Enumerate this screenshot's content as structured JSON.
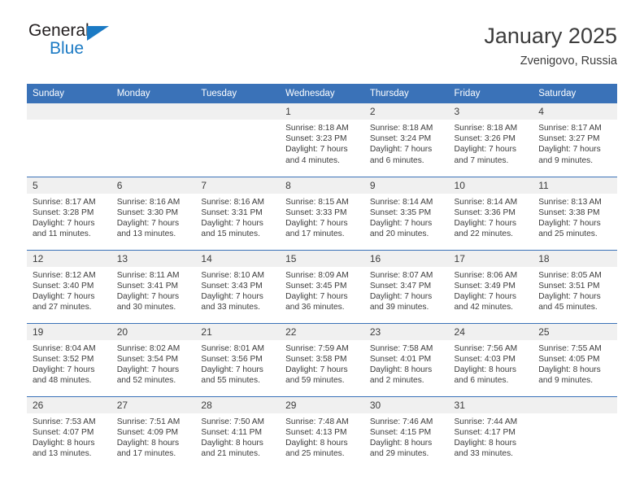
{
  "brand": {
    "name_part1": "General",
    "name_part2": "Blue",
    "triangle_icon": "triangle-icon",
    "accent_color": "#1b7ac4"
  },
  "header": {
    "title": "January 2025",
    "subtitle": "Zvenigovo, Russia"
  },
  "theme": {
    "header_blue": "#3a72b8",
    "daynum_band": "#f0f0f0",
    "text_color": "#3c3c3c"
  },
  "weekdays": [
    "Sunday",
    "Monday",
    "Tuesday",
    "Wednesday",
    "Thursday",
    "Friday",
    "Saturday"
  ],
  "labels": {
    "sunrise": "Sunrise:",
    "sunset": "Sunset:",
    "daylight": "Daylight:"
  },
  "weeks": [
    [
      {
        "day": "",
        "empty": true
      },
      {
        "day": "",
        "empty": true
      },
      {
        "day": "",
        "empty": true
      },
      {
        "day": "1",
        "sunrise": "Sunrise: 8:18 AM",
        "sunset": "Sunset: 3:23 PM",
        "daylight_line1": "Daylight: 7 hours",
        "daylight_line2": "and 4 minutes."
      },
      {
        "day": "2",
        "sunrise": "Sunrise: 8:18 AM",
        "sunset": "Sunset: 3:24 PM",
        "daylight_line1": "Daylight: 7 hours",
        "daylight_line2": "and 6 minutes."
      },
      {
        "day": "3",
        "sunrise": "Sunrise: 8:18 AM",
        "sunset": "Sunset: 3:26 PM",
        "daylight_line1": "Daylight: 7 hours",
        "daylight_line2": "and 7 minutes."
      },
      {
        "day": "4",
        "sunrise": "Sunrise: 8:17 AM",
        "sunset": "Sunset: 3:27 PM",
        "daylight_line1": "Daylight: 7 hours",
        "daylight_line2": "and 9 minutes."
      }
    ],
    [
      {
        "day": "5",
        "sunrise": "Sunrise: 8:17 AM",
        "sunset": "Sunset: 3:28 PM",
        "daylight_line1": "Daylight: 7 hours",
        "daylight_line2": "and 11 minutes."
      },
      {
        "day": "6",
        "sunrise": "Sunrise: 8:16 AM",
        "sunset": "Sunset: 3:30 PM",
        "daylight_line1": "Daylight: 7 hours",
        "daylight_line2": "and 13 minutes."
      },
      {
        "day": "7",
        "sunrise": "Sunrise: 8:16 AM",
        "sunset": "Sunset: 3:31 PM",
        "daylight_line1": "Daylight: 7 hours",
        "daylight_line2": "and 15 minutes."
      },
      {
        "day": "8",
        "sunrise": "Sunrise: 8:15 AM",
        "sunset": "Sunset: 3:33 PM",
        "daylight_line1": "Daylight: 7 hours",
        "daylight_line2": "and 17 minutes."
      },
      {
        "day": "9",
        "sunrise": "Sunrise: 8:14 AM",
        "sunset": "Sunset: 3:35 PM",
        "daylight_line1": "Daylight: 7 hours",
        "daylight_line2": "and 20 minutes."
      },
      {
        "day": "10",
        "sunrise": "Sunrise: 8:14 AM",
        "sunset": "Sunset: 3:36 PM",
        "daylight_line1": "Daylight: 7 hours",
        "daylight_line2": "and 22 minutes."
      },
      {
        "day": "11",
        "sunrise": "Sunrise: 8:13 AM",
        "sunset": "Sunset: 3:38 PM",
        "daylight_line1": "Daylight: 7 hours",
        "daylight_line2": "and 25 minutes."
      }
    ],
    [
      {
        "day": "12",
        "sunrise": "Sunrise: 8:12 AM",
        "sunset": "Sunset: 3:40 PM",
        "daylight_line1": "Daylight: 7 hours",
        "daylight_line2": "and 27 minutes."
      },
      {
        "day": "13",
        "sunrise": "Sunrise: 8:11 AM",
        "sunset": "Sunset: 3:41 PM",
        "daylight_line1": "Daylight: 7 hours",
        "daylight_line2": "and 30 minutes."
      },
      {
        "day": "14",
        "sunrise": "Sunrise: 8:10 AM",
        "sunset": "Sunset: 3:43 PM",
        "daylight_line1": "Daylight: 7 hours",
        "daylight_line2": "and 33 minutes."
      },
      {
        "day": "15",
        "sunrise": "Sunrise: 8:09 AM",
        "sunset": "Sunset: 3:45 PM",
        "daylight_line1": "Daylight: 7 hours",
        "daylight_line2": "and 36 minutes."
      },
      {
        "day": "16",
        "sunrise": "Sunrise: 8:07 AM",
        "sunset": "Sunset: 3:47 PM",
        "daylight_line1": "Daylight: 7 hours",
        "daylight_line2": "and 39 minutes."
      },
      {
        "day": "17",
        "sunrise": "Sunrise: 8:06 AM",
        "sunset": "Sunset: 3:49 PM",
        "daylight_line1": "Daylight: 7 hours",
        "daylight_line2": "and 42 minutes."
      },
      {
        "day": "18",
        "sunrise": "Sunrise: 8:05 AM",
        "sunset": "Sunset: 3:51 PM",
        "daylight_line1": "Daylight: 7 hours",
        "daylight_line2": "and 45 minutes."
      }
    ],
    [
      {
        "day": "19",
        "sunrise": "Sunrise: 8:04 AM",
        "sunset": "Sunset: 3:52 PM",
        "daylight_line1": "Daylight: 7 hours",
        "daylight_line2": "and 48 minutes."
      },
      {
        "day": "20",
        "sunrise": "Sunrise: 8:02 AM",
        "sunset": "Sunset: 3:54 PM",
        "daylight_line1": "Daylight: 7 hours",
        "daylight_line2": "and 52 minutes."
      },
      {
        "day": "21",
        "sunrise": "Sunrise: 8:01 AM",
        "sunset": "Sunset: 3:56 PM",
        "daylight_line1": "Daylight: 7 hours",
        "daylight_line2": "and 55 minutes."
      },
      {
        "day": "22",
        "sunrise": "Sunrise: 7:59 AM",
        "sunset": "Sunset: 3:58 PM",
        "daylight_line1": "Daylight: 7 hours",
        "daylight_line2": "and 59 minutes."
      },
      {
        "day": "23",
        "sunrise": "Sunrise: 7:58 AM",
        "sunset": "Sunset: 4:01 PM",
        "daylight_line1": "Daylight: 8 hours",
        "daylight_line2": "and 2 minutes."
      },
      {
        "day": "24",
        "sunrise": "Sunrise: 7:56 AM",
        "sunset": "Sunset: 4:03 PM",
        "daylight_line1": "Daylight: 8 hours",
        "daylight_line2": "and 6 minutes."
      },
      {
        "day": "25",
        "sunrise": "Sunrise: 7:55 AM",
        "sunset": "Sunset: 4:05 PM",
        "daylight_line1": "Daylight: 8 hours",
        "daylight_line2": "and 9 minutes."
      }
    ],
    [
      {
        "day": "26",
        "sunrise": "Sunrise: 7:53 AM",
        "sunset": "Sunset: 4:07 PM",
        "daylight_line1": "Daylight: 8 hours",
        "daylight_line2": "and 13 minutes."
      },
      {
        "day": "27",
        "sunrise": "Sunrise: 7:51 AM",
        "sunset": "Sunset: 4:09 PM",
        "daylight_line1": "Daylight: 8 hours",
        "daylight_line2": "and 17 minutes."
      },
      {
        "day": "28",
        "sunrise": "Sunrise: 7:50 AM",
        "sunset": "Sunset: 4:11 PM",
        "daylight_line1": "Daylight: 8 hours",
        "daylight_line2": "and 21 minutes."
      },
      {
        "day": "29",
        "sunrise": "Sunrise: 7:48 AM",
        "sunset": "Sunset: 4:13 PM",
        "daylight_line1": "Daylight: 8 hours",
        "daylight_line2": "and 25 minutes."
      },
      {
        "day": "30",
        "sunrise": "Sunrise: 7:46 AM",
        "sunset": "Sunset: 4:15 PM",
        "daylight_line1": "Daylight: 8 hours",
        "daylight_line2": "and 29 minutes."
      },
      {
        "day": "31",
        "sunrise": "Sunrise: 7:44 AM",
        "sunset": "Sunset: 4:17 PM",
        "daylight_line1": "Daylight: 8 hours",
        "daylight_line2": "and 33 minutes."
      },
      {
        "day": "",
        "empty": true
      }
    ]
  ]
}
